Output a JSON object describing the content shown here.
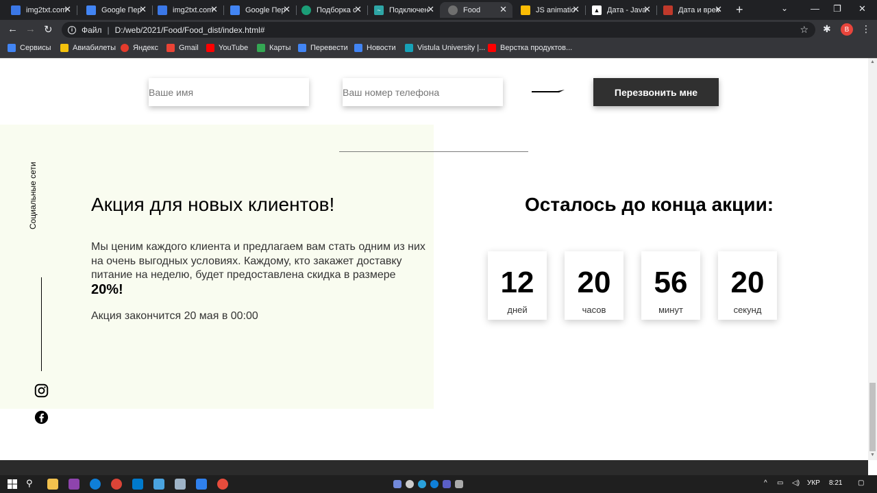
{
  "browser": {
    "tabs": [
      {
        "title": "img2txt.com",
        "color": "#3b78e7"
      },
      {
        "title": "Google Пер",
        "color": "#4285f4"
      },
      {
        "title": "img2txt.com",
        "color": "#3b78e7"
      },
      {
        "title": "Google Пер",
        "color": "#4285f4"
      },
      {
        "title": "Подборка с",
        "color": "#1b9e77"
      },
      {
        "title": "Подключен",
        "color": "#2ea6a6"
      },
      {
        "title": "Food",
        "color": "#6f6f6f"
      },
      {
        "title": "JS animatio",
        "color": "#fbbc04"
      },
      {
        "title": "Дата - Java",
        "color": "#111111"
      },
      {
        "title": "Дата и врем",
        "color": "#c0392b"
      }
    ],
    "address": {
      "scheme": "Файл",
      "url": "D:/web/2021/Food/Food_dist/index.html#"
    },
    "profile_letter": "B",
    "bookmarks": [
      {
        "label": "Сервисы",
        "color": "#4285f4"
      },
      {
        "label": "Авиабилеты",
        "color": "#f4c20d"
      },
      {
        "label": "Яндекс",
        "color": "#e43b2c"
      },
      {
        "label": "Gmail",
        "color": "#ea4335"
      },
      {
        "label": "YouTube",
        "color": "#ff0000"
      },
      {
        "label": "Карты",
        "color": "#34a853"
      },
      {
        "label": "Перевести",
        "color": "#4285f4"
      },
      {
        "label": "Новости",
        "color": "#4285f4"
      },
      {
        "label": "Vistula University |...",
        "color": "#17a2b8"
      },
      {
        "label": "Верстка продуктов...",
        "color": "#ff0000"
      }
    ]
  },
  "order": {
    "name_placeholder": "Ваше имя",
    "phone_placeholder": "Ваш номер телефона",
    "submit_label": "Перезвонить мне"
  },
  "social": {
    "label": "Социальные сети"
  },
  "promo": {
    "title": "Акция для новых клиентов!",
    "text": "Мы ценим каждого клиента и предлагаем вам стать одним из них на очень выгодных условиях. Каждому, кто закажет доставку питание на неделю, будет предоставлена скидка в размере",
    "discount": "20%!",
    "end": "Акция закончится 20 мая в 00:00"
  },
  "timer": {
    "title": "Осталось до конца акции:",
    "items": [
      {
        "value": "12",
        "unit": "дней"
      },
      {
        "value": "20",
        "unit": "часов"
      },
      {
        "value": "56",
        "unit": "минут"
      },
      {
        "value": "20",
        "unit": "секунд"
      }
    ]
  },
  "taskbar": {
    "lang": "УКР",
    "time": "8:21"
  },
  "colors": {
    "promo_bg": "#f9fcf0",
    "button_dark": "#303030"
  }
}
